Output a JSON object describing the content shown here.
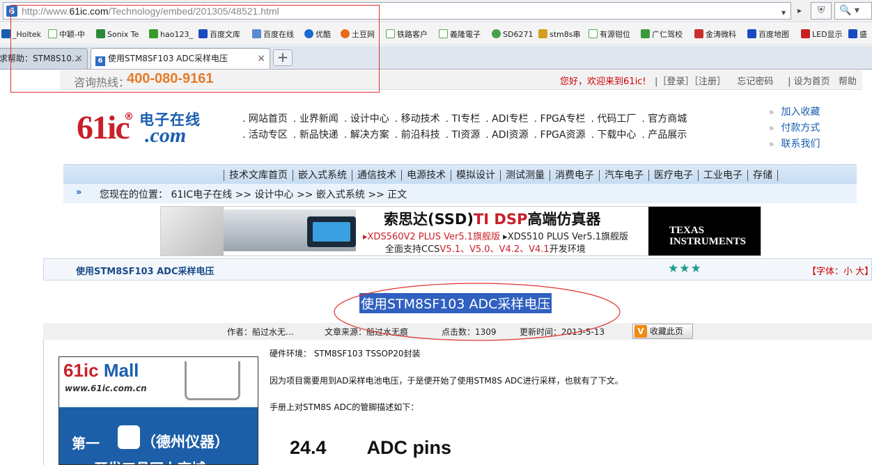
{
  "browser": {
    "url_prefix": "http://www.",
    "url_domain": "61ic.com",
    "url_path": "/Technology/embed/201305/48521.html",
    "favicon_letter": "6",
    "dropdown": "▾",
    "forward": "▸",
    "shield": "⛨",
    "search": "🔍 ▾",
    "bookmarks": [
      "_Holtek",
      "中颖-中",
      "Sonix Te",
      "hao123_",
      "百度文库",
      "百度在线",
      "优酷",
      "土豆网",
      "铁路客户",
      "義隆電子",
      "SD6271",
      "stm8s串",
      "有源钳位",
      "广仁驾校",
      "金涛微科",
      "百度地图",
      "LED显示",
      "盛"
    ],
    "tabs": [
      {
        "label": "求帮助：STM8S10…",
        "close": "×"
      },
      {
        "label": "使用STM8SF103 ADC采样电压",
        "close": "×"
      }
    ],
    "new_tab": "+"
  },
  "header": {
    "hotline_label": "咨询热线：",
    "hotline_number": "400-080-9161",
    "welcome": "您好，欢迎来到61ic!",
    "login": "|［登录］［注册］",
    "forgot": "忘记密码",
    "sethome": "| 设为首页",
    "help": "帮助"
  },
  "logo": {
    "num": "61ic",
    "reg": "®",
    "cn": "电子在线",
    "com": ".com"
  },
  "menu_row1": [
    "网站首页",
    "业界新闻",
    "设计中心",
    "移动技术",
    "TI专栏",
    "ADI专栏",
    "FPGA专栏",
    "代码工厂",
    "官方商城"
  ],
  "menu_row2": [
    "活动专区",
    "新品快递",
    "解决方案",
    "前沿科技",
    "TI资源",
    "ADI资源",
    "FPGA资源",
    "下载中心",
    "产品展示"
  ],
  "side_links": [
    "加入收藏",
    "付款方式",
    "联系我们"
  ],
  "side_arrow": "»",
  "categories": [
    "技术文库首页",
    "嵌入式系统",
    "通信技术",
    "电源技术",
    "模拟设计",
    "测试测量",
    "消费电子",
    "汽车电子",
    "医疗电子",
    "工业电子",
    "存储"
  ],
  "breadcrumb": {
    "arrow": "»",
    "text": "您现在的位置： 61IC电子在线 >> 设计中心 >> 嵌入式系统 >> 正文"
  },
  "banner": {
    "title_a": "索思达(SSD)",
    "title_b": "TI DSP",
    "title_c": "高端仿真器",
    "line2_a": "▸XDS560V2 PLUS Ver5.1旗舰版",
    "line2_b": " ▸XDS510 PLUS Ver5.1旗舰版",
    "line3_a": "全面支持CCS",
    "line3_b": "V5.1、V5.0、V4.2、V4.1",
    "line3_c": "开发环境",
    "ti_logo": "TEXAS INSTRUMENTS"
  },
  "article": {
    "bar_title": "使用STM8SF103 ADC采样电压",
    "stars": "★★★",
    "font_size": "【字体：小 大】",
    "title": "使用STM8SF103 ADC采样电压",
    "author": "作者：船过水无…",
    "source": "文章来源：船过水无痕",
    "clicks": "点击数：1309",
    "updated": "更新时间：2013-5-13",
    "favorite_icon": "V",
    "favorite": "收藏此页",
    "para1": "硬件环境：  STM8SF103 TSSOP20封装",
    "para2": "因为项目需要用到AD采样电池电压，于是便开始了使用STM8S ADC进行采样，也就有了下文。",
    "para3": "手册上对STM8S ADC的管脚描述如下：",
    "section_num": "24.4",
    "section_title": "ADC pins"
  },
  "ad": {
    "mall_a": "61ic",
    "mall_b": " Mall",
    "url": "www.61ic.com.cn",
    "line1": "第一",
    "line2": "（德州仪器）",
    "line3": "开发工具网上商城"
  }
}
